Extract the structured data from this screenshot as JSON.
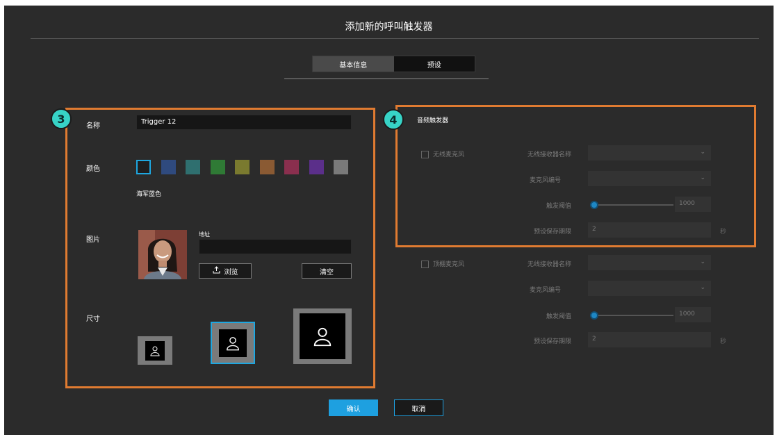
{
  "dialog": {
    "title": "添加新的呼叫触发器"
  },
  "tabs": [
    {
      "label": "基本信息",
      "active": true
    },
    {
      "label": "预设",
      "active": false
    }
  ],
  "annotations": {
    "left_badge": "3",
    "right_badge": "4"
  },
  "basic": {
    "name_label": "名称",
    "name_value": "Trigger 12",
    "color_label": "颜色",
    "colors": [
      "#1f1f1f",
      "#2f4a7e",
      "#2f6f6f",
      "#2f7a35",
      "#7a7a2f",
      "#8a5a33",
      "#8a2f4e",
      "#5b2f8a",
      "#7a7a7a"
    ],
    "color_selected_border": "#1ea7e0",
    "color_name": "海军蓝色",
    "image_label": "图片",
    "address_label": "地址",
    "address_value": "",
    "browse_label": "浏览",
    "browse_icon": "upload-icon",
    "clear_label": "清空",
    "size_label": "尺寸",
    "sizes_icon": "person-icon"
  },
  "audio": {
    "title": "音频触发器",
    "groups": [
      {
        "checkbox_label": "无线麦克风",
        "receiver_label": "无线接收器名称",
        "mic_label": "麦克风编号",
        "threshold_label": "触发阈值",
        "threshold_value": "1000",
        "preset_label": "预设保存期限",
        "preset_value": "2",
        "preset_unit": "秒"
      },
      {
        "checkbox_label": "顶棚麦克风",
        "receiver_label": "无线接收器名称",
        "mic_label": "麦克风编号",
        "threshold_label": "触发阈值",
        "threshold_value": "1000",
        "preset_label": "预设保存期限",
        "preset_value": "2",
        "preset_unit": "秒"
      }
    ]
  },
  "footer": {
    "confirm_label": "确认",
    "cancel_label": "取消"
  },
  "theme": {
    "accent": "#1ea0e0",
    "annotation_orange": "#e07b31",
    "badge": "#37d3c6"
  }
}
